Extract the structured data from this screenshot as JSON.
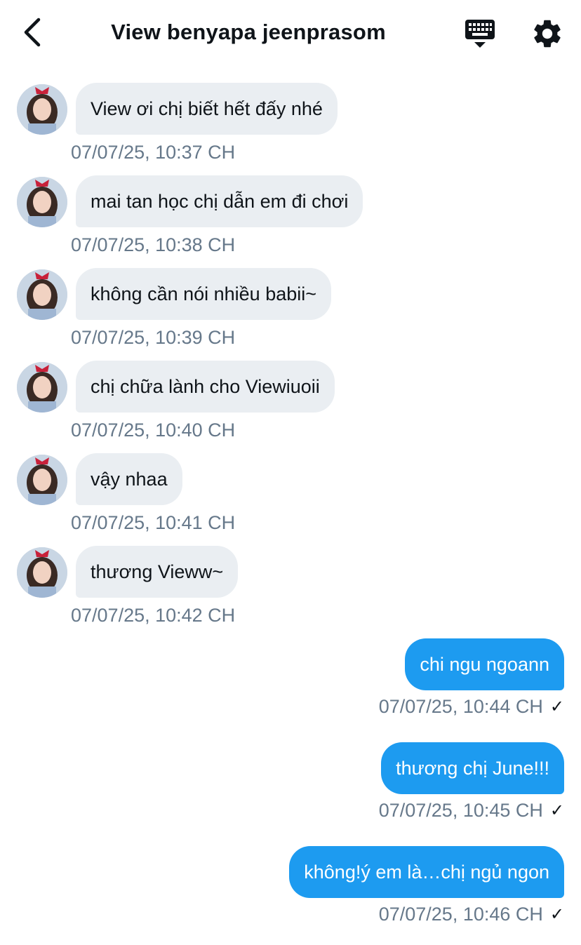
{
  "header": {
    "title": "View benyapa jeenprasom",
    "back_icon": "chevron-left-icon",
    "keyboard_icon": "keyboard-icon",
    "settings_icon": "gear-icon"
  },
  "colors": {
    "incoming_bubble": "#eaeef2",
    "outgoing_bubble": "#1d9bf0",
    "timestamp": "#66788a"
  },
  "messages": [
    {
      "direction": "in",
      "text": "View ơi chị biết hết đấy nhé",
      "time": "07/07/25, 10:37 CH"
    },
    {
      "direction": "in",
      "text": "mai tan học chị dẫn em đi chơi",
      "time": "07/07/25, 10:38 CH"
    },
    {
      "direction": "in",
      "text": "không cần nói nhiều babii~",
      "time": "07/07/25, 10:39 CH"
    },
    {
      "direction": "in",
      "text": "chị chữa lành cho Viewiuoii",
      "time": "07/07/25, 10:40 CH"
    },
    {
      "direction": "in",
      "text": "vậy nhaa",
      "time": "07/07/25, 10:41 CH"
    },
    {
      "direction": "in",
      "text": "thương Vieww~",
      "time": "07/07/25, 10:42 CH"
    },
    {
      "direction": "out",
      "text": "chi ngu ngoann",
      "time": "07/07/25, 10:44 CH",
      "status": "✓"
    },
    {
      "direction": "out",
      "text": "thương chị June!!!",
      "time": "07/07/25, 10:45 CH",
      "status": "✓"
    },
    {
      "direction": "out",
      "text": "không!ý em là…chị ngủ ngon",
      "time": "07/07/25, 10:46 CH",
      "status": "✓"
    }
  ]
}
